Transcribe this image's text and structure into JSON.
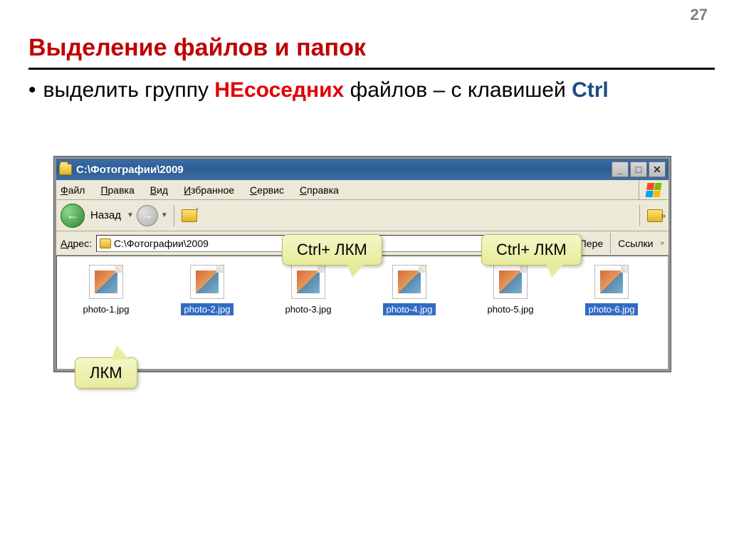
{
  "page_number": "27",
  "title": "Выделение файлов и папок",
  "bullet": {
    "prefix": "выделить группу ",
    "highlight": "НЕсоседних",
    "mid": " файлов – с клавишей ",
    "key": "Ctrl"
  },
  "window": {
    "title": "C:\\Фотографии\\2009",
    "menu": [
      "Файл",
      "Правка",
      "Вид",
      "Избранное",
      "Сервис",
      "Справка"
    ],
    "back_label": "Назад",
    "address_label": "Адрес:",
    "address_value": "C:\\Фотографии\\2009",
    "go_label": "Пере",
    "links_label": "Ссылки"
  },
  "files": [
    {
      "name": "photo-1.jpg",
      "selected": false
    },
    {
      "name": "photo-2.jpg",
      "selected": true
    },
    {
      "name": "photo-3.jpg",
      "selected": false
    },
    {
      "name": "photo-4.jpg",
      "selected": true
    },
    {
      "name": "photo-5.jpg",
      "selected": false
    },
    {
      "name": "photo-6.jpg",
      "selected": true
    }
  ],
  "callouts": {
    "lkm": "ЛКМ",
    "ctrl1": "Ctrl+ ЛКМ",
    "ctrl2": "Ctrl+ ЛКМ"
  }
}
